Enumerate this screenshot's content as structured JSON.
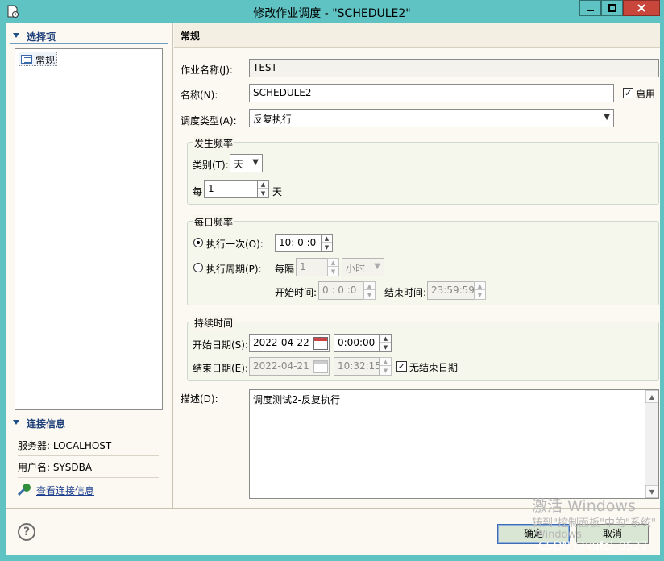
{
  "window": {
    "title": "修改作业调度 - \"SCHEDULE2\""
  },
  "left_panel": {
    "select_header": "选择项",
    "tree_items": [
      "常规"
    ],
    "connection_header": "连接信息",
    "server": "服务器: LOCALHOST",
    "user": "用户名: SYSDBA",
    "view_connection_link": "查看连接信息"
  },
  "general": {
    "header": "常规",
    "job_name_label": "作业名称(J):",
    "job_name_value": "TEST",
    "name_label": "名称(N):",
    "name_value": "SCHEDULE2",
    "enabled_label": "启用",
    "enabled": true,
    "schedule_type_label": "调度类型(A):",
    "schedule_type_value": "反复执行"
  },
  "frequency": {
    "group_title": "发生频率",
    "category_label": "类别(T):",
    "category_value": "天",
    "every_label": "每",
    "every_value": "1",
    "every_unit": "天"
  },
  "daily_frequency": {
    "group_title": "每日频率",
    "once_label": "执行一次(O):",
    "once_value": "10: 0 :0",
    "periodic_label": "执行周期(P):",
    "interval_label": "每隔",
    "interval_value": "1",
    "interval_unit": "小时",
    "start_time_label": "开始时间:",
    "start_time_value": "0 : 0 :0",
    "end_time_label": "结束时间:",
    "end_time_value": "23:59:59",
    "selected_option": "once"
  },
  "duration": {
    "group_title": "持续时间",
    "start_date_label": "开始日期(S):",
    "start_date_value": "2022-04-22",
    "start_time_value": "0:00:00",
    "end_date_label": "结束日期(E):",
    "end_date_value": "2022-04-21",
    "end_time_value": "10:32:15",
    "no_end_date_label": "无结束日期",
    "no_end_date": true
  },
  "description": {
    "label": "描述(D):",
    "value": "调度测试2-反复执行"
  },
  "buttons": {
    "ok": "确定",
    "cancel": "取消"
  },
  "watermark": {
    "activate_title": "激活 Windows",
    "activate_sub": "转到\"控制面板\"中的\"系统\"",
    "activate_sub2": "Windows",
    "csdn": "CSDN @xufei_9527"
  },
  "colors": {
    "window_frame": "#5fc3c3",
    "client_bg": "#fbf9f1",
    "close_button": "#c9463d",
    "button_bg": "#d9e6d4"
  }
}
